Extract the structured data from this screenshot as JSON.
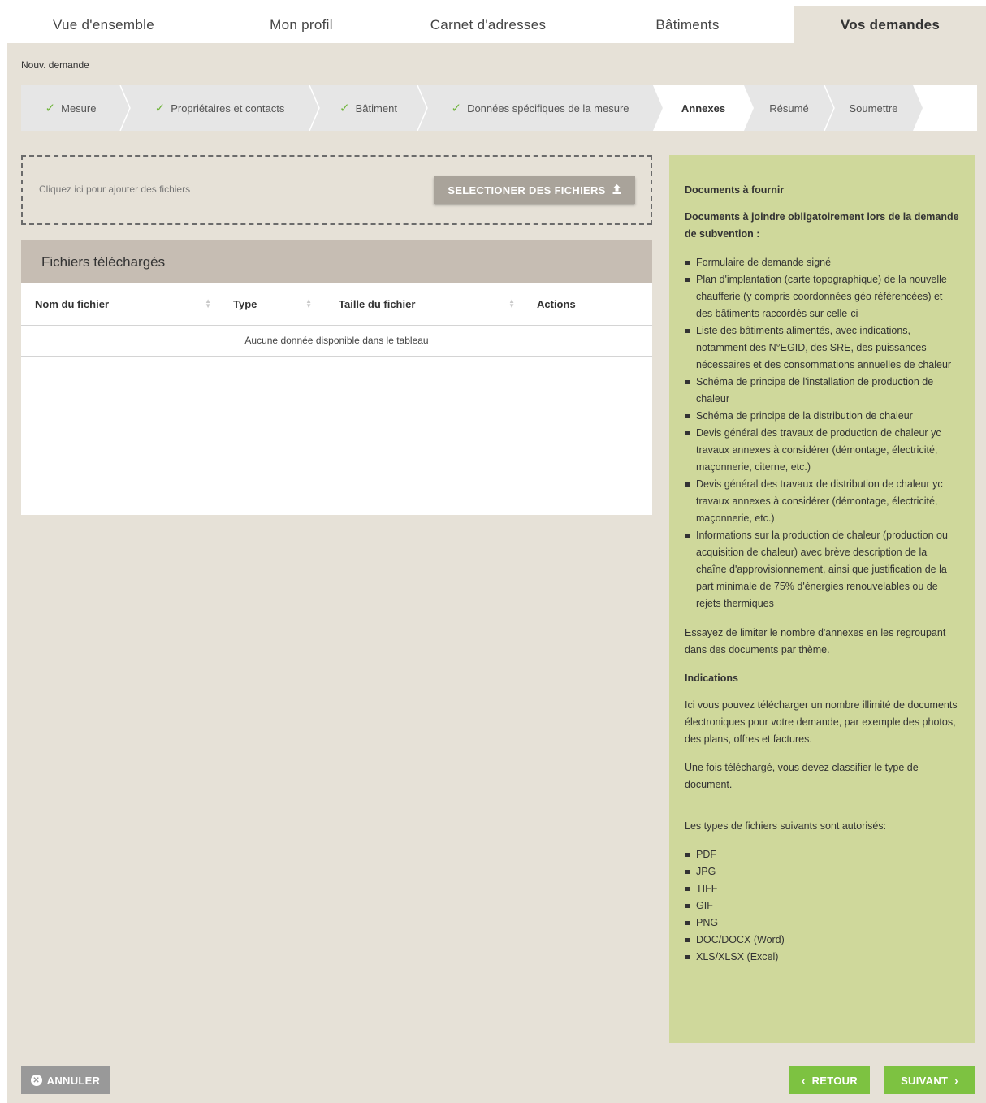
{
  "tabs": [
    {
      "label": "Vue d'ensemble"
    },
    {
      "label": "Mon profil"
    },
    {
      "label": "Carnet d'adresses"
    },
    {
      "label": "Bâtiments"
    },
    {
      "label": "Vos demandes"
    }
  ],
  "breadcrumb": "Nouv. demande",
  "steps": [
    {
      "label": "Mesure",
      "done": true
    },
    {
      "label": "Propriétaires et contacts",
      "done": true
    },
    {
      "label": "Bâtiment",
      "done": true
    },
    {
      "label": "Données spécifiques de la mesure",
      "done": true
    },
    {
      "label": "Annexes",
      "done": false,
      "active": true
    },
    {
      "label": "Résumé",
      "done": false
    },
    {
      "label": "Soumettre",
      "done": false
    }
  ],
  "dropzone": {
    "text": "Cliquez ici pour ajouter des fichiers",
    "button": "SELECTIONER DES FICHIERS",
    "icon": "upload-icon"
  },
  "files": {
    "title": "Fichiers téléchargés",
    "columns": [
      "Nom du fichier",
      "Type",
      "Taille du fichier",
      "Actions"
    ],
    "empty": "Aucune donnée disponible dans le tableau"
  },
  "info": {
    "heading": "Documents à fournir",
    "intro": "Documents à joindre obligatoirement lors de la demande de subvention :",
    "documents": [
      "Formulaire de demande signé",
      "Plan d'implantation (carte topographique) de la nouvelle chaufferie (y compris coordonnées géo référencées) et des bâtiments raccordés sur celle-ci",
      "Liste des bâtiments alimentés, avec indications, notamment des N°EGID, des SRE, des puissances nécessaires et des consommations annuelles de chaleur",
      "Schéma de principe de l'installation de production de chaleur",
      "Schéma de principe de la distribution de chaleur",
      "Devis général des travaux de production de chaleur yc travaux annexes à considérer (démontage, électricité, maçonnerie, citerne, etc.)",
      "Devis général des travaux de distribution de chaleur yc travaux annexes à considérer (démontage, électricité, maçonnerie, etc.)",
      "Informations sur la production de chaleur (production ou acquisition de chaleur) avec brève description de la chaîne d'approvisionnement, ainsi que justification de la part minimale de 75% d'énergies renouvelables ou de rejets thermiques"
    ],
    "limit_note": "Essayez de limiter le nombre d'annexes en les regroupant dans des documents par thème.",
    "indications_heading": "Indications",
    "indications_1": "Ici vous pouvez télécharger un nombre illimité de documents électroniques pour votre demande, par exemple des photos, des plans, offres et factures.",
    "indications_2": "Une fois téléchargé, vous devez classifier le type de document.",
    "types_intro": "Les types de fichiers suivants sont autorisés:",
    "types": [
      "PDF",
      "JPG",
      "TIFF",
      "GIF",
      "PNG",
      "DOC/DOCX (Word)",
      "XLS/XLSX (Excel)"
    ]
  },
  "buttons": {
    "cancel": "ANNULER",
    "back": "RETOUR",
    "next": "SUIVANT"
  },
  "colors": {
    "background": "#e6e1d7",
    "info_panel": "#cfd89b",
    "files_header": "#c6bdb3",
    "primary_button": "#7dc241",
    "check": "#6fb43a",
    "muted_button": "#999999"
  }
}
